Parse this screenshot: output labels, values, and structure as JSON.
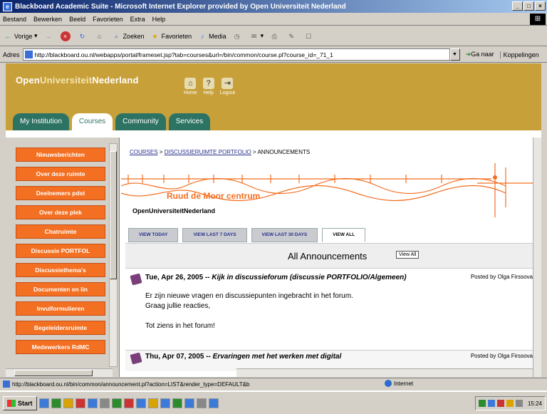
{
  "window": {
    "title": "Blackboard Academic Suite - Microsoft Internet Explorer provided by Open Universiteit Nederland",
    "minimize": "_",
    "maximize": "□",
    "close": "×"
  },
  "menu": {
    "items": [
      "Bestand",
      "Bewerken",
      "Beeld",
      "Favorieten",
      "Extra",
      "Help"
    ]
  },
  "toolbar": {
    "back": "Vorige",
    "search": "Zoeken",
    "favorites": "Favorieten",
    "media": "Media"
  },
  "address": {
    "label": "Adres",
    "url": "http://blackboard.ou.nl/webapps/portal/frameset.jsp?tab=courses&url=/bin/common/course.pl?course_id=_71_1",
    "go": "Ga naar",
    "links": "Koppelingen"
  },
  "portal": {
    "logo_prefix": "Open",
    "logo_mid": "Universiteit",
    "logo_suffix": "Nederland",
    "icons": [
      "Home",
      "Help",
      "Logout"
    ],
    "tabs": [
      {
        "label": "My Institution",
        "active": false
      },
      {
        "label": "Courses",
        "active": true
      },
      {
        "label": "Community",
        "active": false
      },
      {
        "label": "Services",
        "active": false
      }
    ]
  },
  "nav": {
    "items": [
      "Nieuwsberichten",
      "Over deze ruimte",
      "Deelnemers pdst",
      "Over deze plek",
      "Chatruimte",
      "Discussie PORTFOL",
      "Discussiethema's",
      "Documenten en lin",
      "Invulformulieren",
      "Begeleidersruimte",
      "Medewerkers RdMC"
    ]
  },
  "breadcrumb": {
    "courses": "COURSES",
    "sep1": " > ",
    "forum": "DISCUSSIERUIMTE PORTFOLIO",
    "sep2": " > ",
    "current": "ANNOUNCEMENTS"
  },
  "course": {
    "banner_title": "Ruud de Moor centrum",
    "org": "OpenUniversiteitNederland"
  },
  "ann_tabs": [
    "VIEW TODAY",
    "VIEW LAST 7 DAYS",
    "VIEW LAST 30 DAYS",
    "VIEW ALL"
  ],
  "ann_header": {
    "title": "All Announcements",
    "view_all": "View All"
  },
  "announcements": [
    {
      "date": "Tue, Apr 26, 2005",
      "sep": " -- ",
      "title": "Kijk in discussieforum (discussie PORTFOLIO/Algemeen)",
      "posted": "Posted by Olga Firssova",
      "body": [
        "Er zijn nieuwe vragen en discussiepunten ingebracht in het forum.",
        "Graag jullie reacties,",
        "",
        "Tot ziens in het forum!"
      ]
    },
    {
      "date": "Thu, Apr 07, 2005",
      "sep": " -- ",
      "title": "Ervaringen met het werken met digital",
      "posted": "Posted by Olga Firssova",
      "body": []
    }
  ],
  "status": {
    "url": "http://blackboard.ou.nl/bin/common/announcement.pl?action=LIST&render_type=DEFAULT&b",
    "zone": "Internet"
  },
  "taskbar": {
    "start": "Start",
    "clock": "15:24"
  },
  "colors": {
    "banner": "#c8a03a",
    "tab": "#2d7363",
    "nav": "#f36f21"
  }
}
